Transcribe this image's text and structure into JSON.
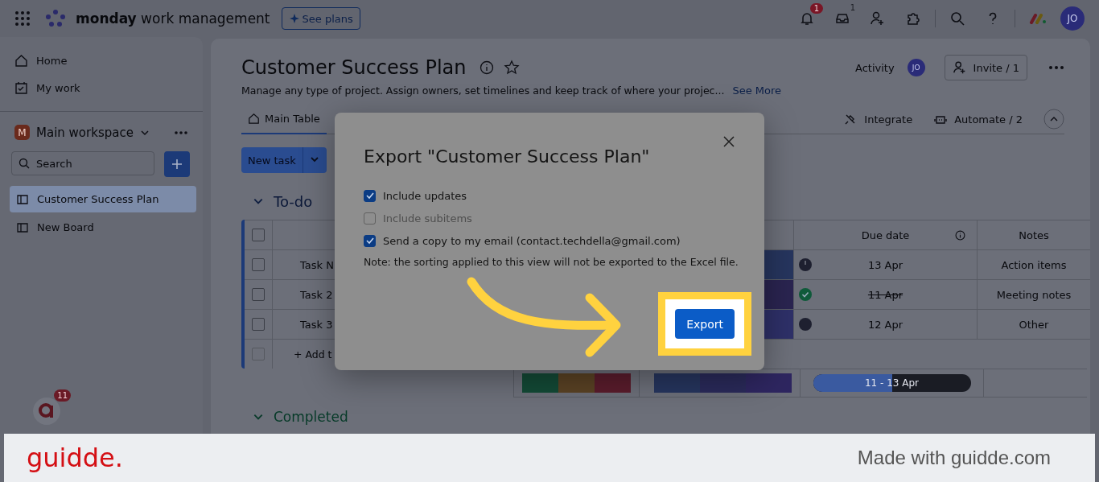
{
  "topbar": {
    "brand": "monday",
    "brand_suffix": "work management",
    "plans_button": "See plans",
    "notifications_badge": "1",
    "inbox_badge": "1",
    "avatar": "JO"
  },
  "sidebar": {
    "nav": [
      {
        "label": "Home"
      },
      {
        "label": "My work"
      }
    ],
    "workspace": {
      "initial": "M",
      "name": "Main workspace"
    },
    "search": {
      "placeholder": "Search"
    },
    "boards": [
      {
        "label": "Customer Success Plan",
        "selected": true
      },
      {
        "label": "New Board",
        "selected": false
      }
    ],
    "assistant_badge": "11"
  },
  "board": {
    "title": "Customer Success Plan",
    "description": "Manage any type of project. Assign owners, set timelines and keep track of where your projec...",
    "see_more": "See More",
    "activity": "Activity",
    "activity_avatar": "JO",
    "invite": "Invite / 1",
    "tabs": [
      {
        "label": "Main Table",
        "selected": true
      }
    ],
    "integrate": "Integrate",
    "automate": "Automate / 2",
    "new_task": "New task"
  },
  "group": {
    "title": "To-do",
    "header_checkbox": {
      "checked": false
    },
    "columns": [
      "Due date",
      "Notes"
    ],
    "rows": [
      {
        "task": "Task N",
        "checked": false,
        "color": "#26355e",
        "kind": "pending",
        "date": "13 Apr",
        "overdue_done": false,
        "notes": "Action items"
      },
      {
        "task": "Task 2",
        "checked": false,
        "color": "#2a2450",
        "kind": "done",
        "date": "11 Apr",
        "overdue_done": true,
        "notes": "Meeting notes"
      },
      {
        "task": "Task 3",
        "checked": false,
        "color": "#2e3068",
        "kind": "empty",
        "date": "12 Apr",
        "overdue_done": false,
        "notes": "Other"
      }
    ],
    "add_item": {
      "label": "+ Add t",
      "checked": false
    },
    "timeline": {
      "label": "11 - 13 Apr",
      "level": 0.5
    }
  },
  "group2": {
    "title": "Completed"
  },
  "dialog": {
    "title": "Export \"Customer Success Plan\"",
    "options": [
      {
        "label": "Include updates",
        "checked": true,
        "disabled": false
      },
      {
        "label": "Include subitems",
        "checked": false,
        "disabled": true
      },
      {
        "label": "Send a copy to my email (contact.techdella@gmail.com)",
        "checked": true,
        "disabled": false
      }
    ],
    "note": "Note: the sorting applied to this view will not be exported to the Excel file.",
    "button": "Export"
  },
  "footer": {
    "brand": "guidde.",
    "text": "Made with guidde.com"
  }
}
